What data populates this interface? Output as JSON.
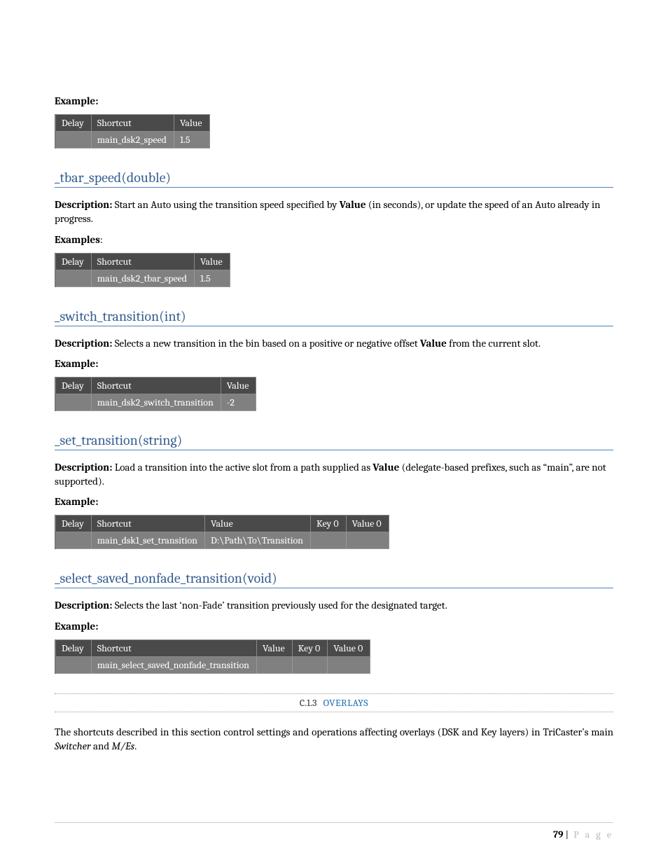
{
  "labels": {
    "example": "Example:",
    "examples": "Examples",
    "colon": ":"
  },
  "headers": {
    "delay": "Delay",
    "shortcut": "Shortcut",
    "value": "Value",
    "key0": "Key 0",
    "value0": "Value 0"
  },
  "table1": {
    "delay": "",
    "shortcut": "main_dsk2_speed",
    "value": "1.5"
  },
  "sec_tbar": {
    "heading": "_tbar_speed(double)",
    "desc_b1": "Description:",
    "desc_t1": " Start an Auto using the transition speed specified by ",
    "desc_b2": "Value",
    "desc_t2": " (in seconds), or update the speed of an Auto already in progress."
  },
  "table2": {
    "delay": "",
    "shortcut": "main_dsk2_tbar_speed",
    "value": "1.5"
  },
  "sec_switch": {
    "heading": "_switch_transition(int)",
    "desc_b1": "Description:",
    "desc_t1": " Selects a new transition in the bin based on a positive or negative offset ",
    "desc_b2": "Value",
    "desc_t2": " from the current slot."
  },
  "table3": {
    "delay": "",
    "shortcut": "main_dsk2_switch_transition",
    "value": "-2"
  },
  "sec_set": {
    "heading": "_set_transition(string)",
    "desc_b1": "Description:",
    "desc_t1": " Load a transition into the active slot from a path supplied as ",
    "desc_b2": "Value",
    "desc_t2": " (delegate-based prefixes, such as “main”, are not supported)."
  },
  "table4": {
    "delay": "",
    "shortcut": "main_dsk1_set_transition",
    "value": "D:\\Path\\To\\Transition",
    "key0": "",
    "value0": ""
  },
  "sec_select": {
    "heading": "_select_saved_nonfade_transition(void)",
    "desc_b1": "Description:",
    "desc_t1": " Selects the last ‘non-Fade’ transition previously used for the designated target."
  },
  "table5": {
    "delay": "",
    "shortcut": "main_select_saved_nonfade_transition",
    "value": "",
    "key0": "",
    "value0": ""
  },
  "subsection": {
    "num": "C.1.3",
    "title": "OVERLAYS"
  },
  "overlays_text": {
    "t1": "The shortcuts described in this section control settings and operations affecting overlays (DSK and Key layers) in TriCaster’s main ",
    "i1": "Switcher",
    "t2": " and ",
    "i2": "M/Es",
    "t3": "."
  },
  "footer": {
    "page": "79",
    "sep": " | ",
    "label": "P a g e"
  }
}
